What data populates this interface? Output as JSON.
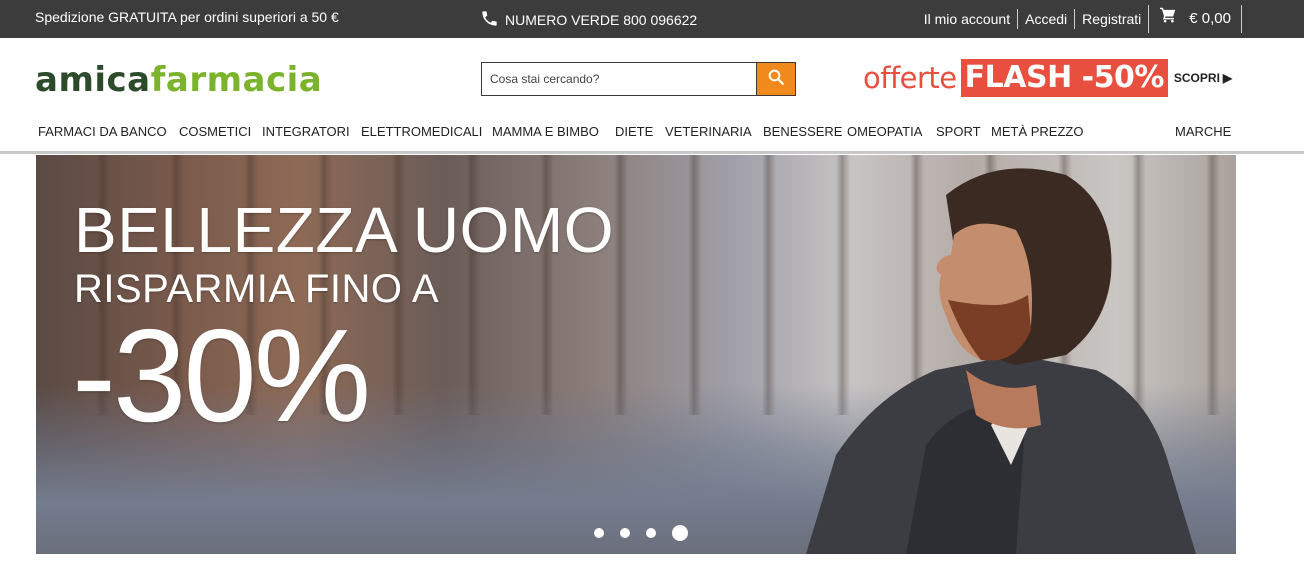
{
  "topbar": {
    "shipping": "Spedizione GRATUITA per ordini superiori a 50 €",
    "phone_label": "NUMERO VERDE 800 096622",
    "account": "Il mio account",
    "login": "Accedi",
    "register": "Registrati",
    "cart_total": "€ 0,00"
  },
  "header": {
    "logo_part1": "amica",
    "logo_part2": "farmacia",
    "search_placeholder": "Cosa stai cercando?",
    "flash_prefix": "offerte",
    "flash_badge": "FLASH -50%",
    "flash_cta": "SCOPRI"
  },
  "nav": {
    "items": [
      "FARMACI DA BANCO",
      "COSMETICI",
      "INTEGRATORI",
      "ELETTROMEDICALI",
      "MAMMA E BIMBO",
      "DIETE",
      "VETERINARIA",
      "BENESSERE",
      "OMEOPATIA",
      "SPORT",
      "METÀ PREZZO"
    ],
    "brands": "MARCHE"
  },
  "banner": {
    "line1": "BELLEZZA UOMO",
    "line2": "RISPARMIA FINO A",
    "line3": "-30%",
    "slides": 4,
    "active_slide": 4
  },
  "colors": {
    "topbar_bg": "#3d3c3c",
    "logo_dark": "#2c4b2a",
    "logo_green": "#7bb42c",
    "search_button": "#f08a1c",
    "flash_red": "#e84f3f"
  }
}
